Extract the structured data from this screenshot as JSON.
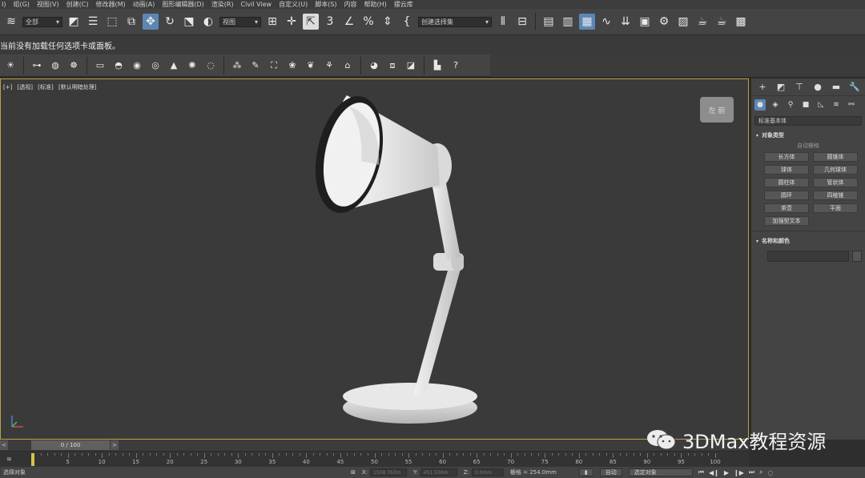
{
  "menu": [
    "I)",
    "组(G)",
    "视图(V)",
    "创建(C)",
    "修改器(M)",
    "动画(A)",
    "图形编辑器(D)",
    "渲染(R)",
    "Civil View",
    "自定义(U)",
    "脚本(S)",
    "内容",
    "帮助(H)",
    "摆云库"
  ],
  "toolbar": {
    "selection_filter": "全部",
    "reference_coord": "视图",
    "named_selection": "创建选择集"
  },
  "message": "当前没有加载任何选项卡或面板。",
  "viewport": {
    "label_plus": "[+]",
    "label_view": "[透视]",
    "label_shading": "[标准]",
    "label_lighting": "[默认明暗处理]",
    "viewcube_text": "左 前"
  },
  "command_panel": {
    "category_dropdown": "标准基本体",
    "object_type_title": "对象类型",
    "autogrid": "自动栅格",
    "buttons": [
      "长方体",
      "圆锥体",
      "球体",
      "几何球体",
      "圆柱体",
      "管状体",
      "圆环",
      "四棱锥",
      "茶壶",
      "平面",
      "加强型文本"
    ],
    "name_color_title": "名称和颜色"
  },
  "timeline": {
    "frame_display": "0 / 100",
    "ticks": [
      "5",
      "10",
      "15",
      "20",
      "25",
      "30",
      "35",
      "40",
      "45",
      "50",
      "55",
      "60",
      "65",
      "70",
      "75",
      "80",
      "85",
      "90",
      "95",
      "100"
    ]
  },
  "status": {
    "selected": "选择对象",
    "x_label": "X:",
    "x_value": "1508.763m",
    "y_label": "Y:",
    "y_value": "451.536m",
    "z_label": "Z:",
    "z_value": "0.0mm",
    "grid": "栅格 = 254.0mm",
    "auto_key": "自动",
    "set_key_filter": "选定对象"
  },
  "watermark": "3DMax教程资源",
  "colors": {
    "active_blue": "#5b87b5",
    "viewport_border": "#b8a24a",
    "time_cursor": "#d9c24a"
  }
}
